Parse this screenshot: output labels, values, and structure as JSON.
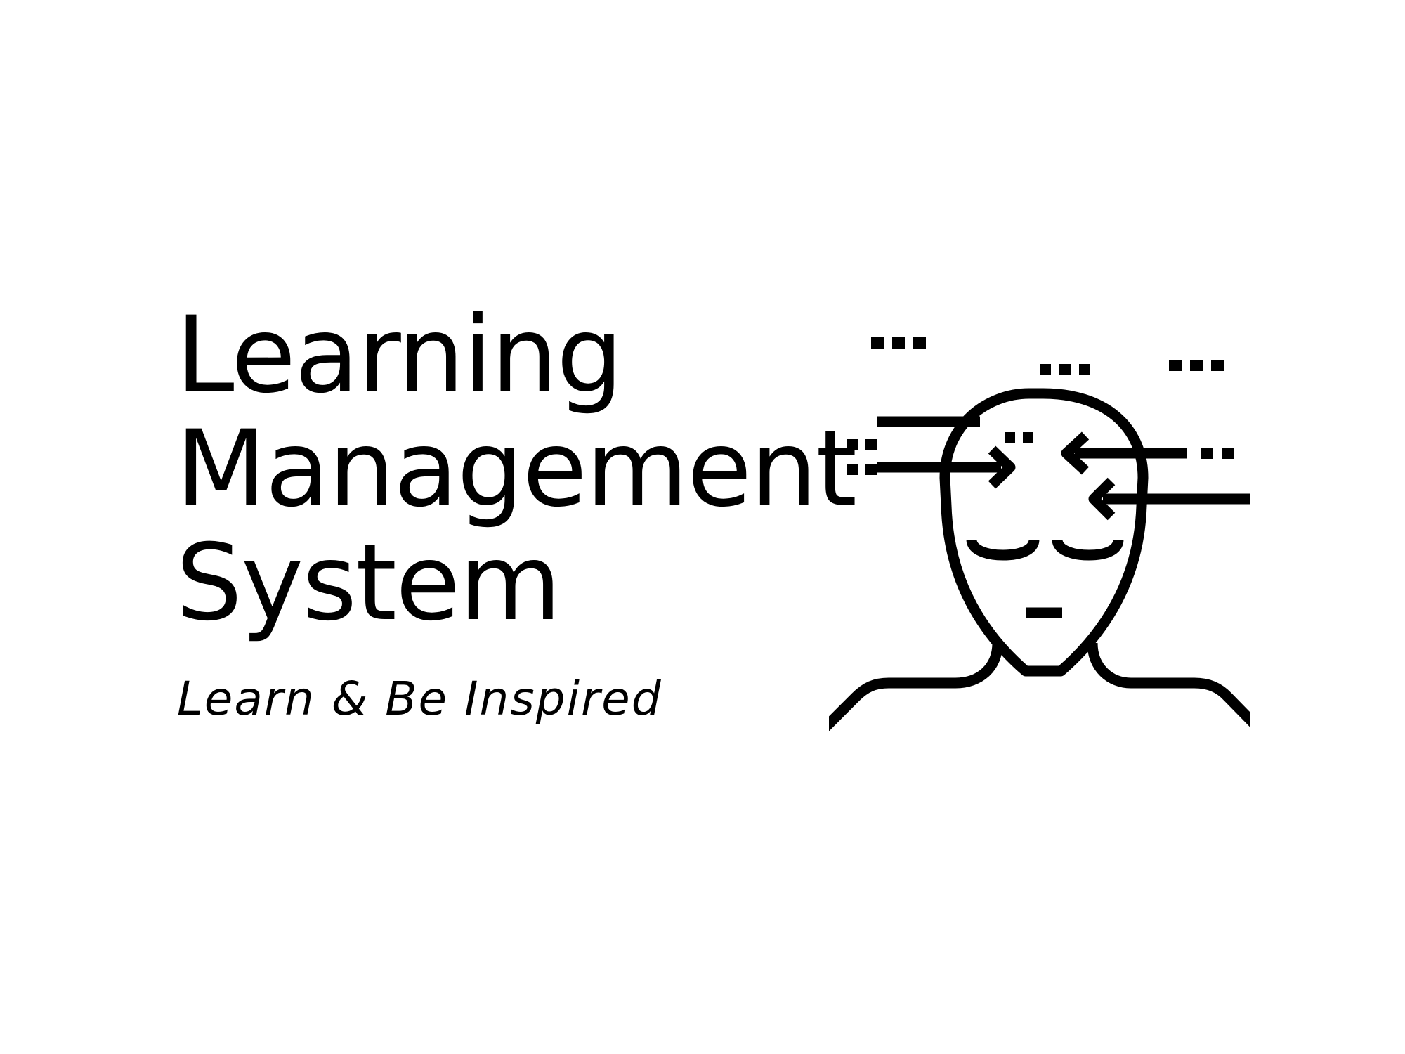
{
  "logo": {
    "title_lines": [
      "Learning",
      "Management",
      "System"
    ],
    "tagline": "Learn & Be Inspired"
  },
  "illustration": {
    "icon": "head-with-inward-arrows-icon",
    "stroke_color": "#000000"
  },
  "colors": {
    "background": "#ffffff",
    "foreground": "#000000"
  }
}
